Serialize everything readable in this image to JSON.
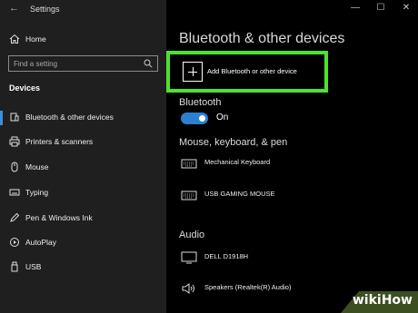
{
  "window": {
    "title": "Settings",
    "controls": [
      "—",
      "☐",
      "✕"
    ]
  },
  "sidebar": {
    "home_label": "Home",
    "search_placeholder": "Find a setting",
    "section_title": "Devices",
    "items": [
      {
        "label": "Bluetooth & other devices",
        "icon": "bluetooth-icon",
        "active": true
      },
      {
        "label": "Printers & scanners",
        "icon": "printer-icon"
      },
      {
        "label": "Mouse",
        "icon": "mouse-icon"
      },
      {
        "label": "Typing",
        "icon": "keyboard-icon"
      },
      {
        "label": "Pen & Windows Ink",
        "icon": "pen-icon"
      },
      {
        "label": "AutoPlay",
        "icon": "autoplay-icon"
      },
      {
        "label": "USB",
        "icon": "usb-icon"
      }
    ]
  },
  "main": {
    "title": "Bluetooth & other devices",
    "add_device_label": "Add Bluetooth or other device",
    "bluetooth_heading": "Bluetooth",
    "bluetooth_state": "On",
    "mouse_section": "Mouse, keyboard, & pen",
    "mouse_devices": [
      {
        "label": "Mechanical Keyboard",
        "icon": "keyboard-icon"
      },
      {
        "label": "USB GAMING MOUSE",
        "icon": "keyboard-icon"
      }
    ],
    "audio_section": "Audio",
    "audio_devices": [
      {
        "label": "DELL D1918H",
        "icon": "monitor-icon"
      },
      {
        "label": "Speakers (Realtek(R) Audio)",
        "icon": "speaker-icon"
      }
    ]
  },
  "colors": {
    "accent": "#2d7fd0",
    "highlight": "#4ce22e",
    "sidebar_bg": "#1f1f1f"
  },
  "watermark": "wikiHow"
}
